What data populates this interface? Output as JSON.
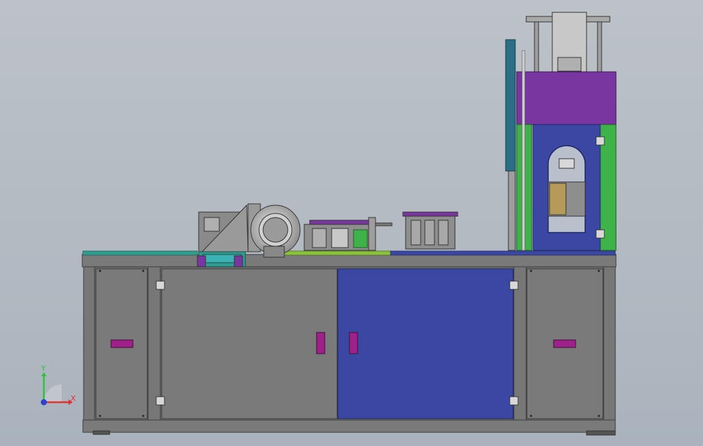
{
  "colors": {
    "background_top": "#bcc2c8",
    "background_bottom": "#aab3bd",
    "cabinet_gray": "#7a7a7a",
    "frame_dark": "#4e4e4e",
    "door_blue": "#3b48a3",
    "hood_purple": "#7a36a0",
    "side_green": "#3fb34a",
    "strip_teal": "#2f9d8f",
    "strip_lime": "#8ac23c",
    "handle_magenta": "#a0208a",
    "column_teal": "#2a6f86",
    "window_tan": "#b59a5a",
    "axis_x": "#e03030",
    "axis_y": "#30c040",
    "axis_z": "#3040d0"
  },
  "triad": {
    "x_label": "X",
    "y_label": "Y",
    "x_icon": "x-axis-arrow-icon",
    "y_icon": "y-axis-arrow-icon",
    "z_icon": "z-axis-dot-icon"
  }
}
